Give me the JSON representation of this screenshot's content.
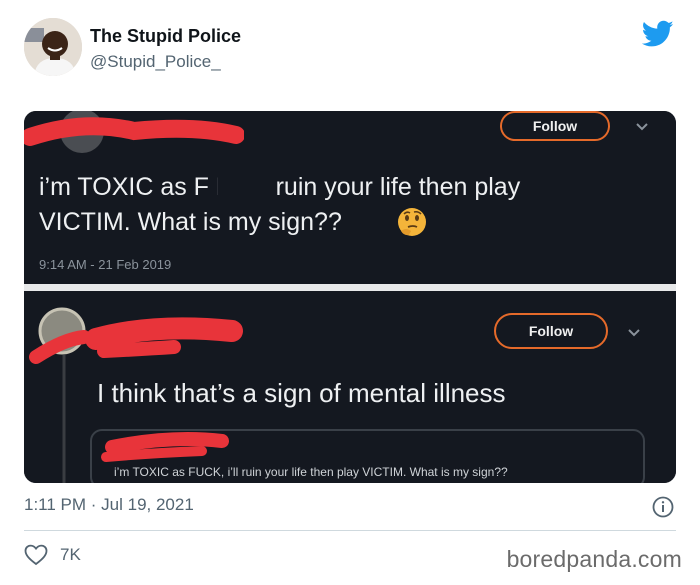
{
  "author": {
    "name": "The Stupid Police",
    "handle": "@Stupid_Police_"
  },
  "embedded": {
    "top": {
      "follow_label": "Follow",
      "text_line1": "i’m TOXIC as F     K, i’ll ruin your life then play",
      "text_line2": "VICTIM. What is my sign??",
      "emoji": "thinking-face",
      "timestamp": "9:14 AM - 21 Feb 2019"
    },
    "bottom": {
      "follow_label": "Follow",
      "text": "I think that’s a sign of mental illness",
      "quoted_preview": "i’m TOXIC as FUCK, i’ll ruin your life then play VICTIM. What is my sign??"
    }
  },
  "tweet": {
    "timestamp": "1:11 PM · Jul 19, 2021",
    "likes": "7K"
  },
  "watermark": "boredpanda.com",
  "colors": {
    "twitter_blue": "#1d9bf0",
    "redaction_red": "#e8343a",
    "follow_border": "#e56a2a"
  }
}
